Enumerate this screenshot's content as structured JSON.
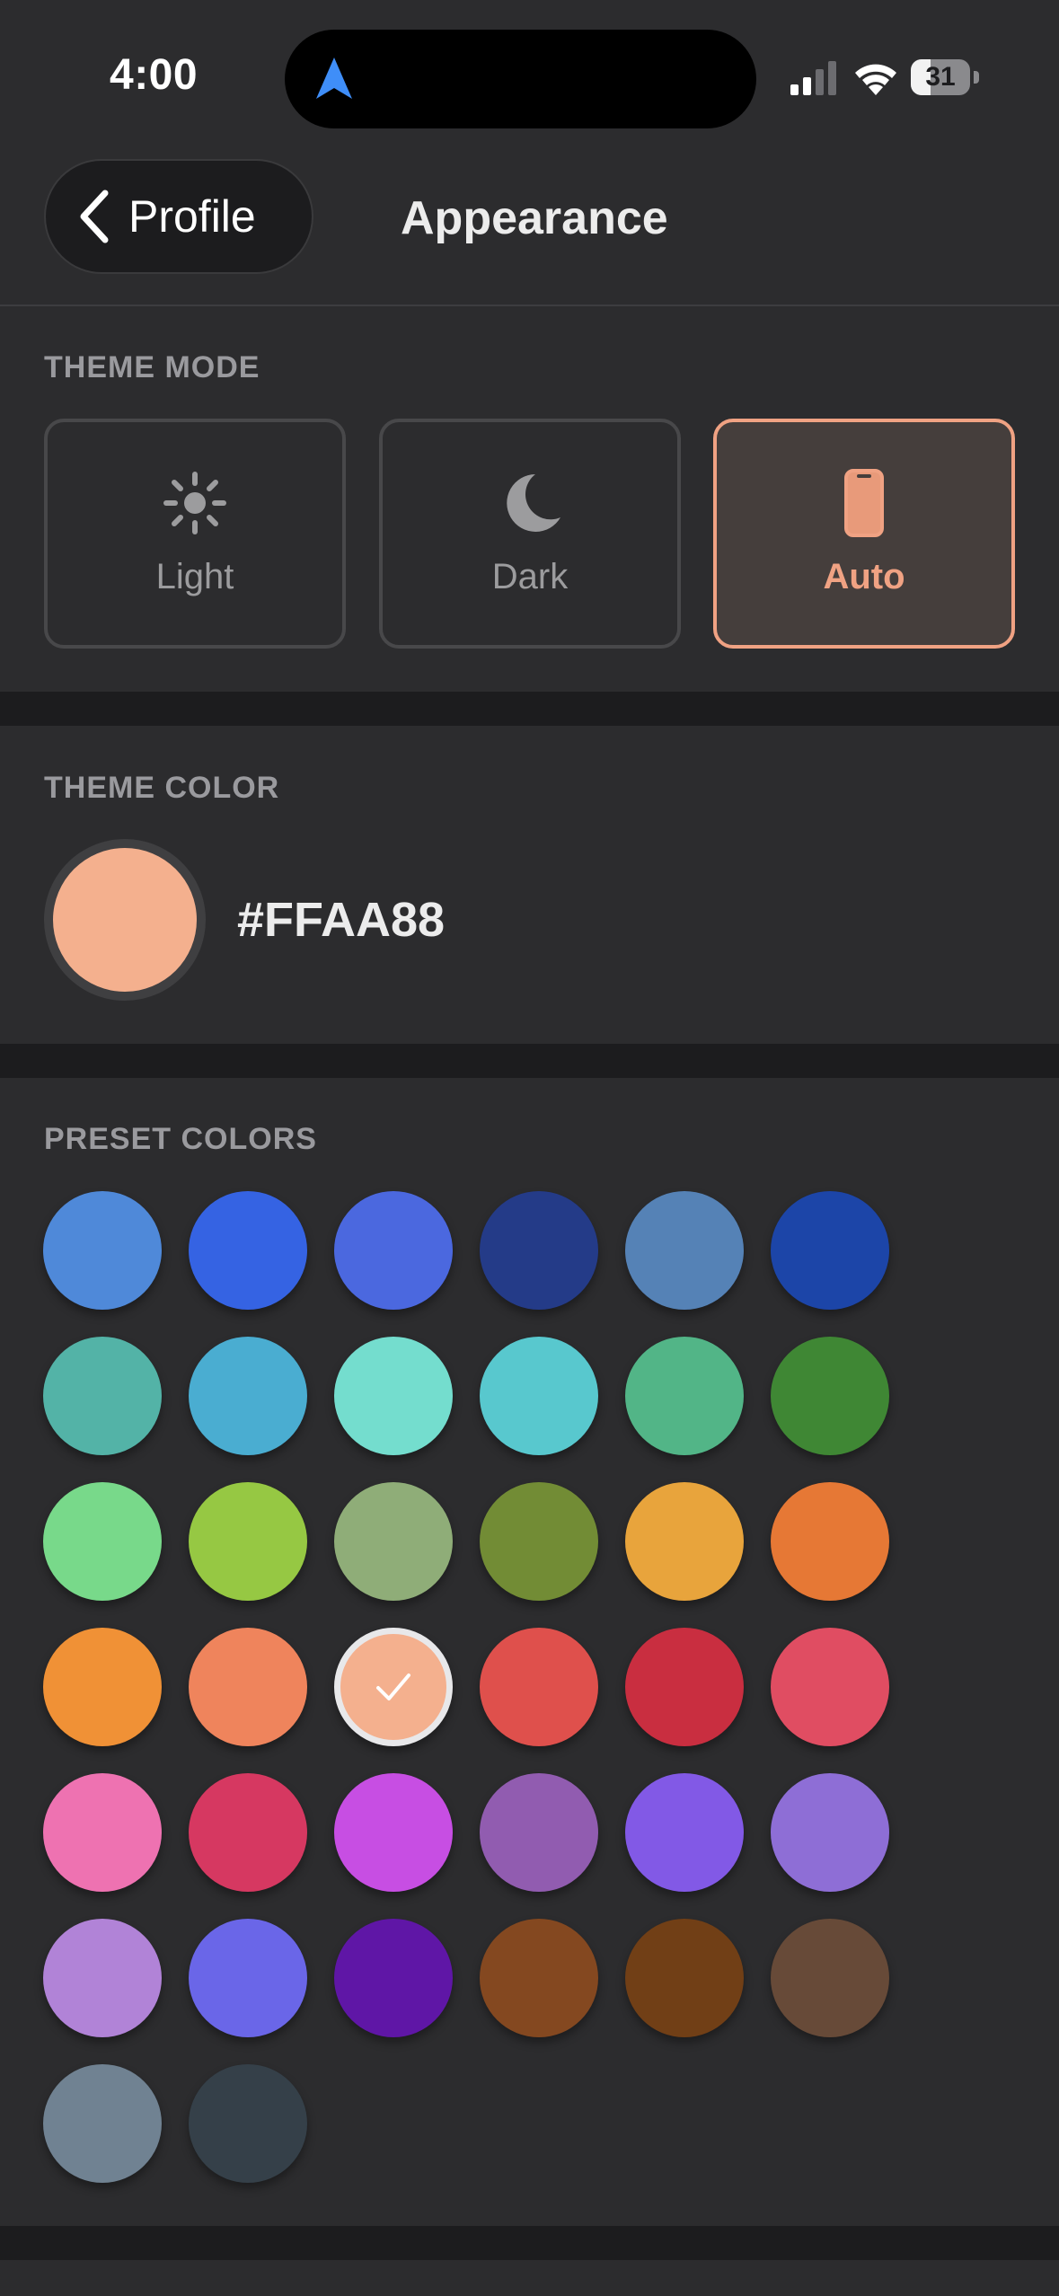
{
  "status": {
    "time": "4:00",
    "battery": "31"
  },
  "nav": {
    "back_label": "Profile",
    "title": "Appearance"
  },
  "theme_mode": {
    "label": "THEME MODE",
    "options": [
      {
        "label": "Light",
        "icon": "sun-icon",
        "selected": false
      },
      {
        "label": "Dark",
        "icon": "moon-icon",
        "selected": false
      },
      {
        "label": "Auto",
        "icon": "phone-icon",
        "selected": true
      }
    ]
  },
  "theme_color": {
    "label": "THEME COLOR",
    "hex": "#FFAA88",
    "swatch": "#f4b08e"
  },
  "preset_colors": {
    "label": "PRESET COLORS",
    "selected_index": 20,
    "colors": [
      "#4f89d9",
      "#3563e3",
      "#4b68df",
      "#243b88",
      "#5582b6",
      "#1c45a8",
      "#53b3a7",
      "#4aadd1",
      "#74ddce",
      "#58c8ce",
      "#52b587",
      "#3f8734",
      "#78d98a",
      "#96c843",
      "#8fad78",
      "#728c35",
      "#e8a43c",
      "#e67835",
      "#f09136",
      "#ef845c",
      "#f4b08e",
      "#df504c",
      "#c92e40",
      "#e04d62",
      "#ee72b1",
      "#d63861",
      "#c74ee3",
      "#915cb0",
      "#8259e6",
      "#8e6ed6",
      "#b183d7",
      "#6a66e8",
      "#5f16a6",
      "#844820",
      "#713f16",
      "#674a38",
      "#708292",
      "#354049"
    ]
  },
  "theme_accent": "#f0a283"
}
